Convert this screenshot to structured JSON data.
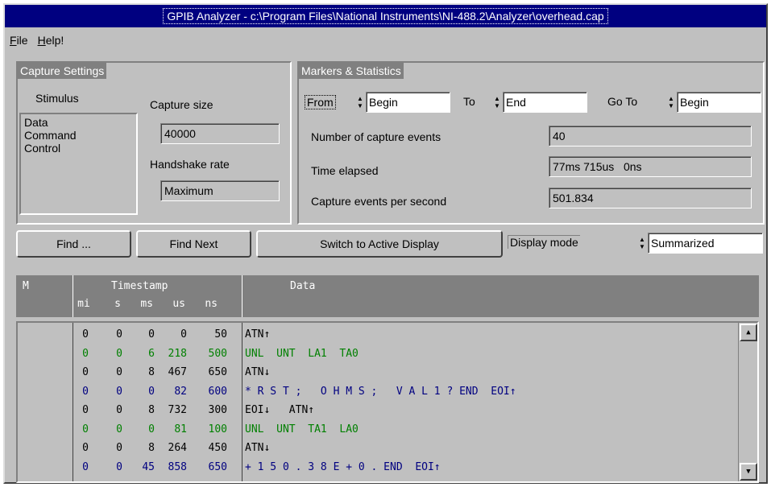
{
  "window": {
    "title": "GPIB Analyzer - c:\\Program Files\\National Instruments\\NI-488.2\\Analyzer\\overhead.cap"
  },
  "menu": {
    "items": [
      {
        "label": "File",
        "accel": "F",
        "rest": "ile"
      },
      {
        "label": "Help!",
        "accel": "H",
        "rest": "elp!"
      }
    ]
  },
  "capture_settings": {
    "title": "Capture Settings",
    "stimulus_label": "Stimulus",
    "stimulus_items": [
      "Data",
      "Command",
      "Control"
    ],
    "capture_size_label": "Capture size",
    "capture_size_value": "40000",
    "handshake_label": "Handshake rate",
    "handshake_value": "Maximum"
  },
  "markers": {
    "title": "Markers & Statistics",
    "from_label": "From",
    "from_value": "Begin",
    "to_label": "To",
    "to_value": "End",
    "goto_label": "Go To",
    "goto_value": "Begin",
    "num_events_label": "Number of capture events",
    "num_events_value": "40",
    "time_elapsed_label": "Time elapsed",
    "time_elapsed_value": "77ms 715us   0ns",
    "events_per_sec_label": "Capture events per second",
    "events_per_sec_value": "501.834"
  },
  "toolbar": {
    "find_label": "Find ...",
    "find_next_label": "Find Next",
    "switch_label": "Switch to Active Display",
    "display_mode_label": "Display mode",
    "display_mode_value": "Summarized"
  },
  "table": {
    "headers": {
      "m": "M",
      "timestamp": "Timestamp",
      "mi": "mi",
      "s": "s",
      "ms": "ms",
      "us": "us",
      "ns": "ns",
      "data": "Data"
    },
    "rows": [
      {
        "mi": "0",
        "s": "0",
        "ms": "0",
        "us": "0",
        "ns": "50",
        "data": "ATN↑",
        "color": "#000000"
      },
      {
        "mi": "0",
        "s": "0",
        "ms": "6",
        "us": "218",
        "ns": "500",
        "data": "UNL  UNT  LA1  TA0",
        "color": "#008000"
      },
      {
        "mi": "0",
        "s": "0",
        "ms": "8",
        "us": "467",
        "ns": "650",
        "data": "ATN↓",
        "color": "#000000"
      },
      {
        "mi": "0",
        "s": "0",
        "ms": "0",
        "us": "82",
        "ns": "600",
        "data": "* R S T ;   O H M S ;   V A L 1 ? END  EOI↑",
        "color": "#000080"
      },
      {
        "mi": "0",
        "s": "0",
        "ms": "8",
        "us": "732",
        "ns": "300",
        "data": "EOI↓   ATN↑",
        "color": "#000000"
      },
      {
        "mi": "0",
        "s": "0",
        "ms": "0",
        "us": "81",
        "ns": "100",
        "data": "UNL  UNT  TA1  LA0",
        "color": "#008000"
      },
      {
        "mi": "0",
        "s": "0",
        "ms": "8",
        "us": "264",
        "ns": "450",
        "data": "ATN↓",
        "color": "#000000"
      },
      {
        "mi": "0",
        "s": "0",
        "ms": "45",
        "us": "858",
        "ns": "650",
        "data": "+ 1 5 0 . 3 8 E + 0 . END  EOI↑",
        "color": "#000080"
      }
    ]
  },
  "icons": {
    "spin": "spin-arrows-icon",
    "scroll_up": "scroll-up-icon",
    "scroll_down": "scroll-down-icon"
  }
}
